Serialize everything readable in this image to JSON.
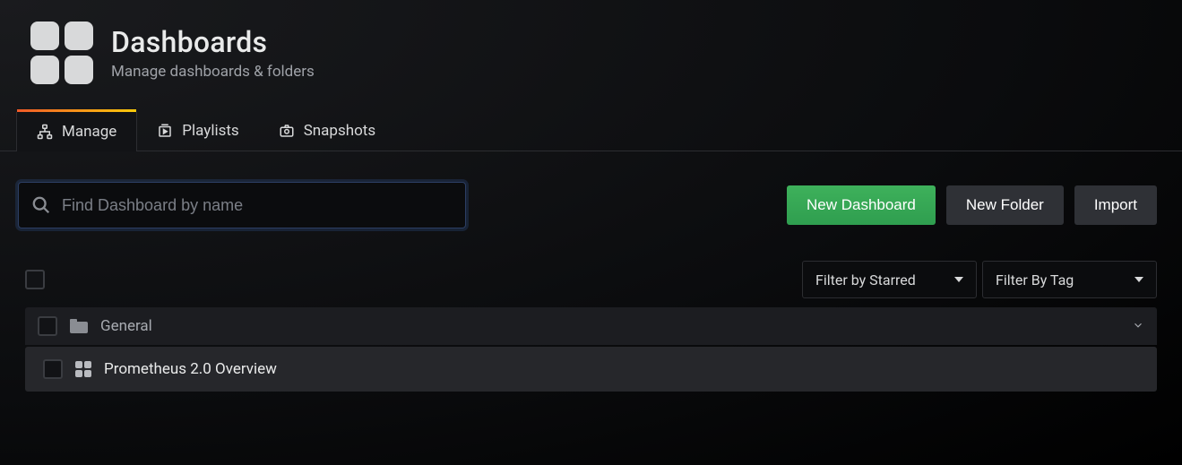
{
  "header": {
    "title": "Dashboards",
    "subtitle": "Manage dashboards & folders"
  },
  "tabs": [
    {
      "label": "Manage",
      "icon": "sitemap-icon",
      "active": true
    },
    {
      "label": "Playlists",
      "icon": "playlist-icon",
      "active": false
    },
    {
      "label": "Snapshots",
      "icon": "camera-icon",
      "active": false
    }
  ],
  "search": {
    "placeholder": "Find Dashboard by name",
    "value": ""
  },
  "buttons": {
    "new_dashboard": "New Dashboard",
    "new_folder": "New Folder",
    "import": "Import"
  },
  "filters": {
    "starred": "Filter by Starred",
    "tag": "Filter By Tag"
  },
  "folder": {
    "name": "General"
  },
  "items": [
    {
      "name": "Prometheus 2.0 Overview"
    }
  ]
}
